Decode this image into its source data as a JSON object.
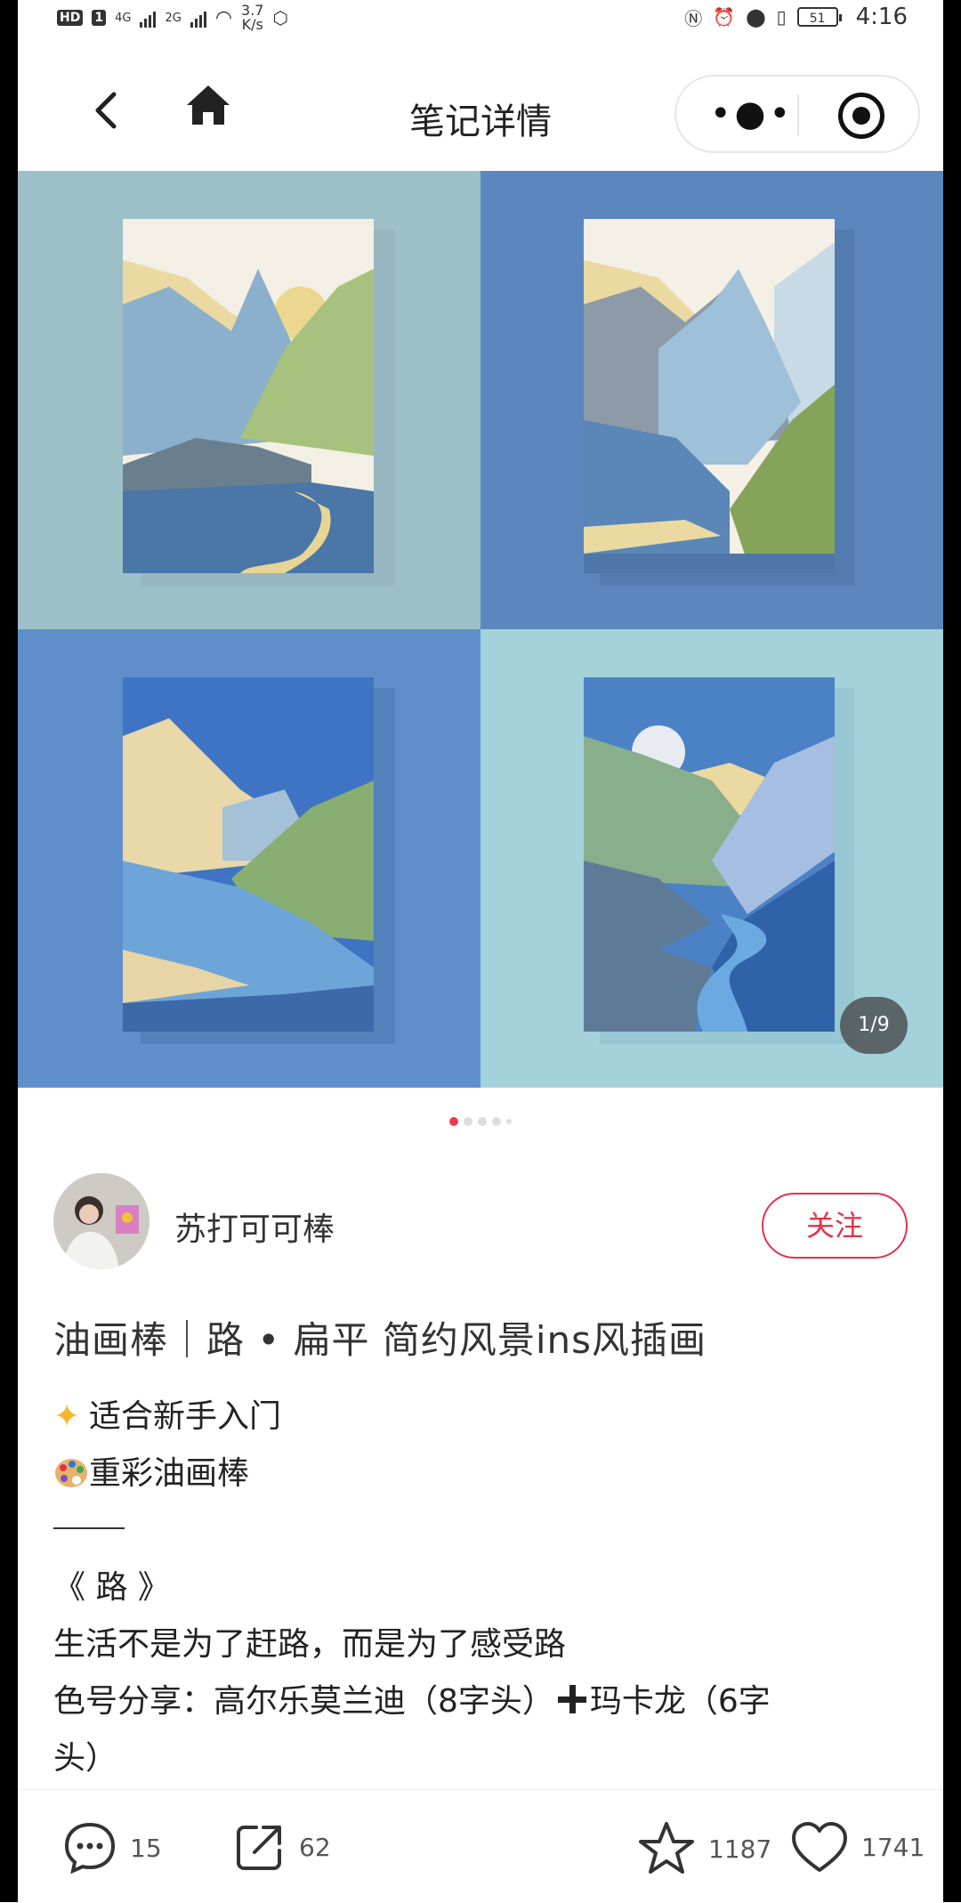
{
  "status_bar": {
    "hd_label": "HD",
    "sim_label": "1",
    "network_1": "4G",
    "network_2": "2G",
    "speed_value": "3.7",
    "speed_unit": "K/s",
    "battery": "51",
    "time": "4:16"
  },
  "nav": {
    "title": "笔记详情"
  },
  "gallery": {
    "counter": "1/9",
    "page_count": 5,
    "active_page": 1
  },
  "author": {
    "name": "苏打可可棒",
    "follow_label": "关注"
  },
  "note": {
    "title": "油画棒｜路 • 扁平 简约风景ins风插画",
    "line1": "适合新手入门",
    "line2": "重彩油画棒",
    "line3": "《 路 》",
    "line4": "生活不是为了赶路，而是为了感受路",
    "line5_a": "色号分享：高尔乐莫兰迪（8字头）",
    "line5_b": "玛卡龙（6字",
    "line6": "头）"
  },
  "actions": {
    "comments": "15",
    "shares": "62",
    "favorites": "1187",
    "likes": "1741"
  },
  "colors": {
    "accent": "#e0324b",
    "pager_active": "#ef3a4e"
  },
  "icons": {
    "back": "chevron-left-icon",
    "home": "home-icon",
    "more": "more-dots-icon",
    "close": "target-icon",
    "comment": "comment-icon",
    "share": "share-icon",
    "star": "star-icon",
    "heart": "heart-icon"
  }
}
